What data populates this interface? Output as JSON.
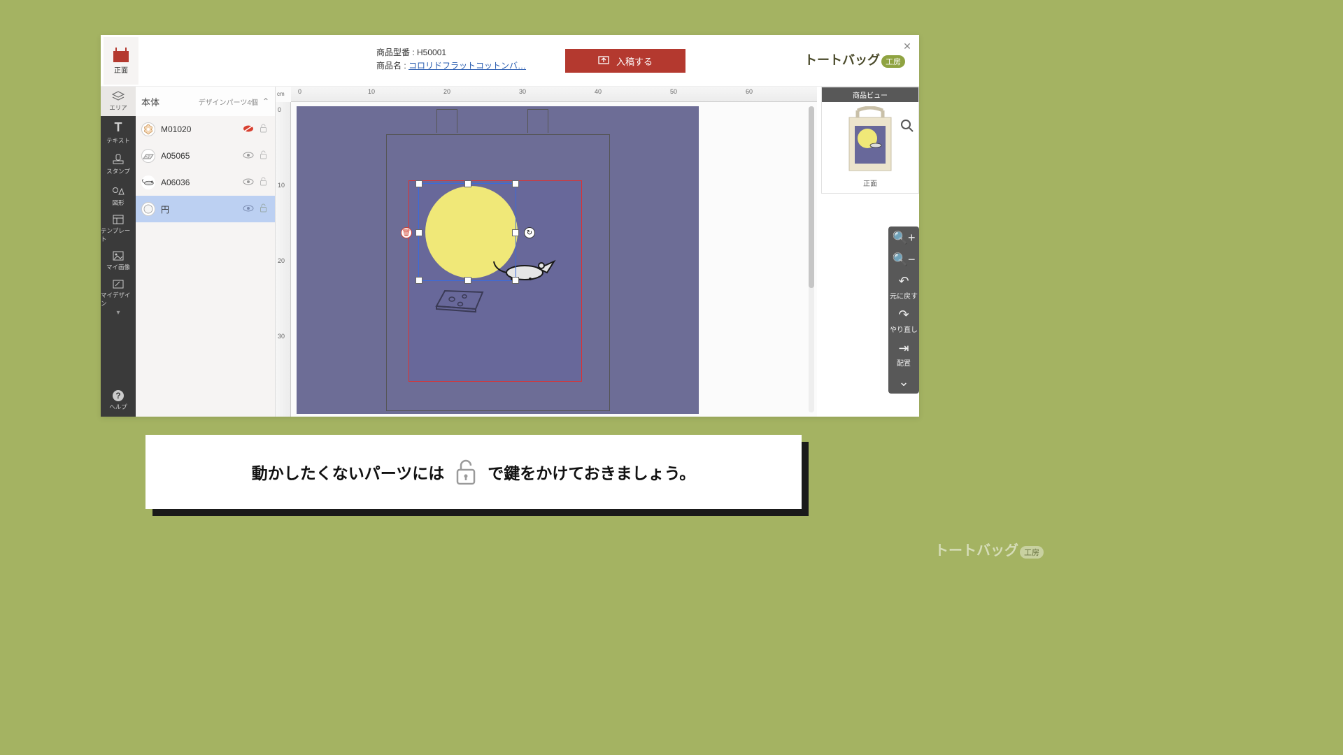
{
  "topbar": {
    "view_tab_label": "正面",
    "model_label": "商品型番 :",
    "model_value": "H50001",
    "name_label": "商品名 :",
    "name_link": "コロリドフラットコットンバ…",
    "submit_label": "入稿する",
    "logo_text": "トートバッグ",
    "logo_badge": "工房"
  },
  "rail": {
    "area": "エリア",
    "text": "テキスト",
    "stamp": "スタンプ",
    "shape": "図形",
    "template": "テンプレート",
    "myimage": "マイ画像",
    "mydesign": "マイデザイン",
    "help": "ヘルプ"
  },
  "layers": {
    "title": "本体",
    "count_label": "デザインパーツ4個",
    "items": [
      {
        "name": "M01020",
        "hidden": true
      },
      {
        "name": "A05065",
        "hidden": false
      },
      {
        "name": "A06036",
        "hidden": false
      },
      {
        "name": "円",
        "hidden": false,
        "selected": true
      }
    ]
  },
  "ruler": {
    "unit": "cm",
    "h": [
      "0",
      "10",
      "20",
      "30",
      "40",
      "50",
      "60"
    ],
    "v": [
      "0",
      "10",
      "20",
      "30"
    ]
  },
  "product_view": {
    "title": "商品ビュー",
    "front": "正面"
  },
  "float_tools": {
    "undo": "元に戻す",
    "redo": "やり直し",
    "placement": "配置"
  },
  "caption": {
    "pre": "動かしたくないパーツには",
    "post": "で鍵をかけておきましょう。"
  },
  "colors": {
    "accent": "#b4392f",
    "canvas_bg": "#6d6d96",
    "purple_inner": "#68689a",
    "moon": "#f0e878",
    "safe_border": "#e03030"
  }
}
